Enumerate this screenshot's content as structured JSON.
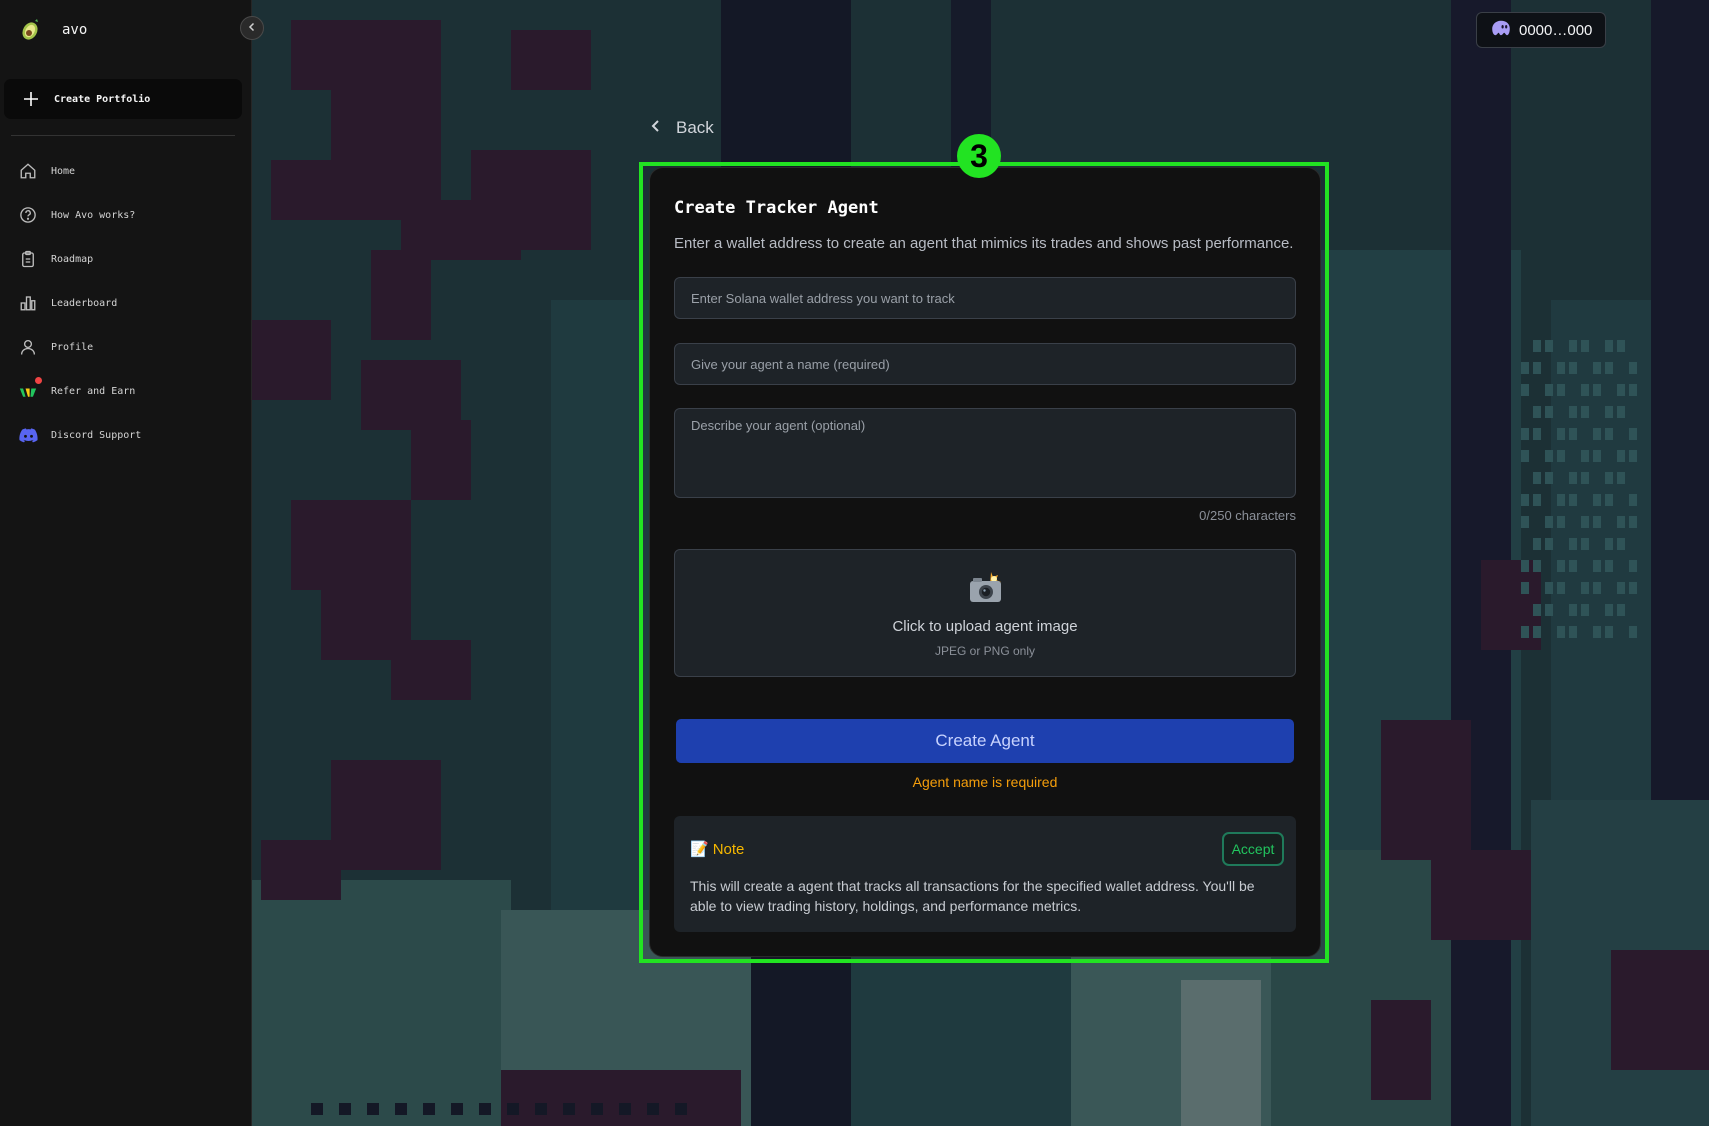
{
  "brand": {
    "name": "avo",
    "logo_icon": "avocado-logo-icon"
  },
  "sidebar": {
    "create_portfolio_label": "Create Portfolio",
    "items": [
      {
        "label": "Home",
        "icon": "home-icon"
      },
      {
        "label": "How Avo works?",
        "icon": "help-circle-icon"
      },
      {
        "label": "Roadmap",
        "icon": "clipboard-icon"
      },
      {
        "label": "Leaderboard",
        "icon": "bar-chart-icon"
      },
      {
        "label": "Profile",
        "icon": "user-icon"
      },
      {
        "label": "Refer and Earn",
        "icon": "gift-icon",
        "notification": true
      },
      {
        "label": "Discord Support",
        "icon": "discord-icon"
      }
    ]
  },
  "header": {
    "wallet_address": "0000…000",
    "wallet_icon": "ghost-wallet-icon"
  },
  "back_label": "Back",
  "step_badge": "3",
  "form": {
    "title": "Create Tracker Agent",
    "description": "Enter a wallet address to create an agent that mimics its trades and shows past performance.",
    "wallet_placeholder": "Enter Solana wallet address you want to track",
    "name_placeholder": "Give your agent a name (required)",
    "description_placeholder": "Describe your agent (optional)",
    "char_counter": "0/250 characters",
    "upload_title": "Click to upload agent image",
    "upload_hint": "JPEG or PNG only",
    "create_button": "Create Agent",
    "error_message": "Agent name is required"
  },
  "note": {
    "emoji": "📝",
    "title": "Note",
    "accept_label": "Accept",
    "body": "This will create a agent that tracks all transactions for the specified wallet address. You'll be able to view trading history, holdings, and performance metrics."
  },
  "colors": {
    "highlight": "#22e322",
    "primary_button": "#1e40af",
    "error": "#f59e0b",
    "note_title": "#f5b700",
    "accept": "#22c55e"
  }
}
